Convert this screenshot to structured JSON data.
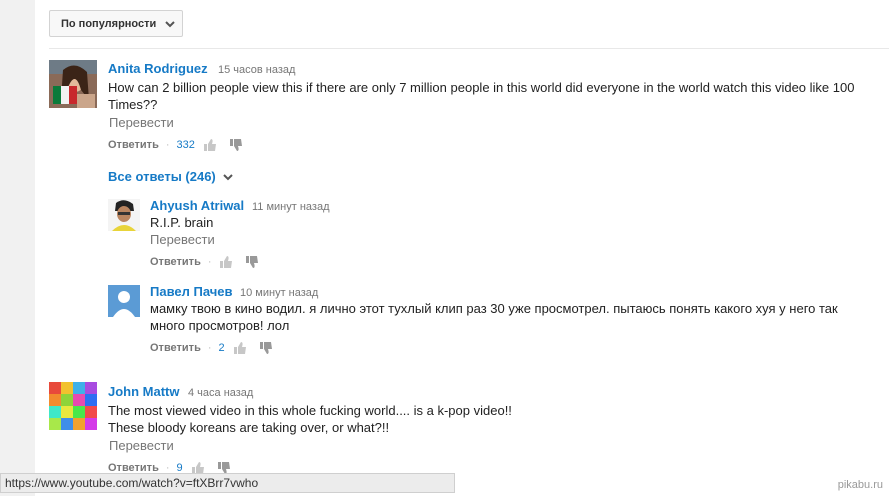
{
  "sort": {
    "label": "По популярности"
  },
  "comments": [
    {
      "author": "Anita Rodriguez",
      "time": "15 часов назад",
      "text": "How can 2 billion people view this if there are only 7 million people in this world did everyone in the world watch this video like 100 Times??",
      "translate": "Перевести",
      "reply": "Ответить",
      "likes": "332"
    },
    {
      "author": "John Mattw",
      "time": "4 часа назад",
      "text_line1": "The most viewed video in this whole fucking world.... is a k-pop video!!",
      "text_line2": "These bloody koreans are taking over, or what?!!",
      "translate": "Перевести",
      "reply": "Ответить",
      "likes": "9"
    }
  ],
  "all_replies": "Все ответы (246)",
  "replies": [
    {
      "author": "Ahyush Atriwal",
      "time": "11 минут назад",
      "text": "R.I.P. brain",
      "translate": "Перевести",
      "reply": "Ответить",
      "likes": ""
    },
    {
      "author": "Павел Пачев",
      "time": "10 минут назад",
      "text": "мамку твою в кино водил. я лично этот тухлый клип раз 30 уже просмотрел. пытаюсь понять какого хуя у него так много просмотров! лол",
      "translate": "",
      "reply": "Ответить",
      "likes": "2"
    }
  ],
  "status_url": "https://www.youtube.com/watch?v=ftXBrr7vwho",
  "watermark": "pikabu.ru",
  "colors": {
    "link": "#167ac6",
    "meta": "#767676",
    "default_avatar": "#5b9bd5"
  },
  "icons": [
    "chevron-down-icon",
    "thumb-up-icon",
    "thumb-down-icon",
    "default-avatar-icon"
  ]
}
